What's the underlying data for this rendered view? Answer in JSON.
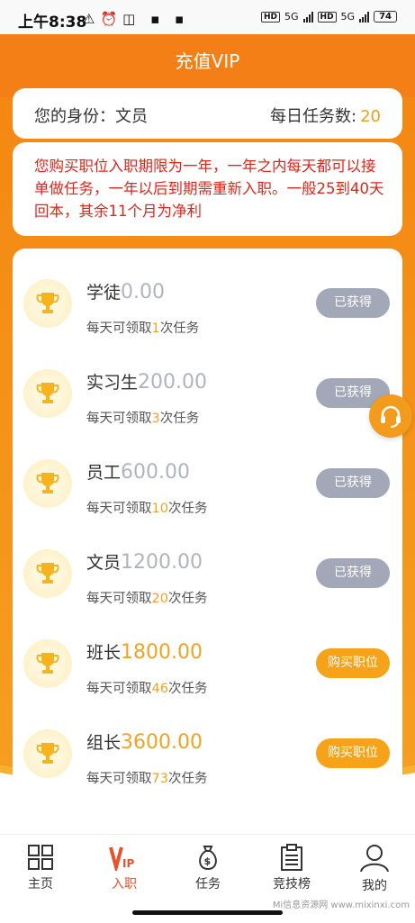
{
  "status": {
    "time": "上午8:38",
    "net1": "5G",
    "net2": "5G",
    "battery": "74"
  },
  "header": {
    "title": "充值VIP"
  },
  "identity": {
    "label": "您的身份：文员",
    "tasks_label": "每日任务数:",
    "tasks_value": "20"
  },
  "notice": "您购买职位入职期限为一年，一年之内每天都可以接单做任务，一年以后到期需重新入职。一般25到40天回本，其余11个月为净利",
  "levels": [
    {
      "name": "学徒",
      "price": "0.00",
      "desc_pre": "每天可领取",
      "count": "1",
      "desc_post": "次任务",
      "button": "已获得",
      "acquired": true
    },
    {
      "name": "实习生",
      "price": "200.00",
      "desc_pre": "每天可领取",
      "count": "3",
      "desc_post": "次任务",
      "button": "已获得",
      "acquired": true
    },
    {
      "name": "员工",
      "price": "600.00",
      "desc_pre": "每天可领取",
      "count": "10",
      "desc_post": "次任务",
      "button": "已获得",
      "acquired": true
    },
    {
      "name": "文员",
      "price": "1200.00",
      "desc_pre": "每天可领取",
      "count": "20",
      "desc_post": "次任务",
      "button": "已获得",
      "acquired": true
    },
    {
      "name": "班长",
      "price": "1800.00",
      "desc_pre": "每天可领取",
      "count": "46",
      "desc_post": "次任务",
      "button": "购买职位",
      "acquired": false
    },
    {
      "name": "组长",
      "price": "3600.00",
      "desc_pre": "每天可领取",
      "count": "73",
      "desc_post": "次任务",
      "button": "购买职位",
      "acquired": false
    }
  ],
  "tabs": [
    {
      "label": "主页",
      "icon": "grid-icon"
    },
    {
      "label": "入职",
      "icon": "vip-icon",
      "active": true
    },
    {
      "label": "任务",
      "icon": "money-bag-icon"
    },
    {
      "label": "竞技榜",
      "icon": "clipboard-icon"
    },
    {
      "label": "我的",
      "icon": "user-icon"
    }
  ],
  "watermark": "Mi信息资源网 www.mixinxi.com",
  "colors": {
    "primary": "#f57f17",
    "accent": "#f7a31a",
    "notice": "#e0261b",
    "acquired_button": "#a2a8b7"
  }
}
